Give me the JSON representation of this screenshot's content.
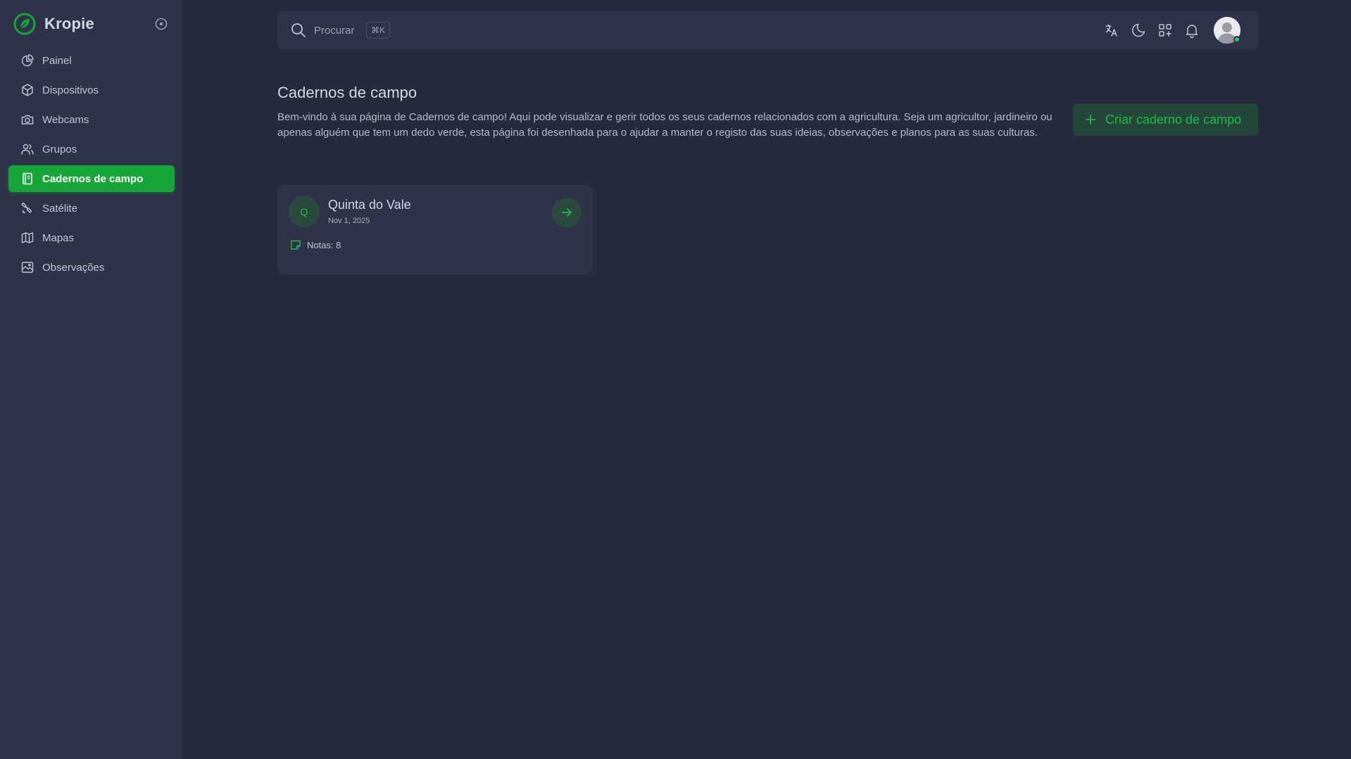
{
  "app": {
    "name": "Kropie",
    "accent_color": "#18a539"
  },
  "sidebar": {
    "items": [
      {
        "label": "Painel",
        "icon": "pie-chart-icon",
        "active": false
      },
      {
        "label": "Dispositivos",
        "icon": "box-icon",
        "active": false
      },
      {
        "label": "Webcams",
        "icon": "camera-icon",
        "active": false
      },
      {
        "label": "Grupos",
        "icon": "users-icon",
        "active": false
      },
      {
        "label": "Cadernos de campo",
        "icon": "notebook-icon",
        "active": true
      },
      {
        "label": "Satélite",
        "icon": "satellite-icon",
        "active": false
      },
      {
        "label": "Mapas",
        "icon": "map-icon",
        "active": false
      },
      {
        "label": "Observações",
        "icon": "photo-icon",
        "active": false
      }
    ]
  },
  "topbar": {
    "search_placeholder": "Procurar",
    "shortcut": "⌘K",
    "icons": [
      "translate-icon",
      "moon-icon",
      "apps-add-icon",
      "bell-icon"
    ],
    "user_status": "online"
  },
  "main": {
    "title": "Cadernos de campo",
    "description": "Bem-vindo à sua página de Cadernos de campo! Aqui pode visualizar e gerir todos os seus cadernos relacionados com a agricultura. Seja um agricultor, jardineiro ou apenas alguém que tem um dedo verde, esta página foi desenhada para o ajudar a manter o registo das suas ideias, observações e planos para as suas culturas.",
    "create_button": "Criar caderno de campo",
    "notebooks": [
      {
        "initial": "Q",
        "title": "Quinta do Vale",
        "date": "Nov 1, 2025",
        "notes": "Notas: 8"
      }
    ]
  }
}
